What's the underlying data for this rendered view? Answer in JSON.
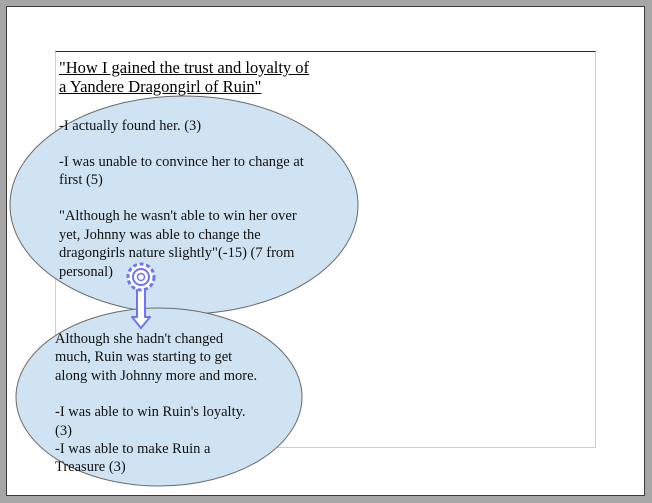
{
  "document": {
    "title_line1": "\"How I gained the trust and loyalty of",
    "title_line2": "a Yandere Dragongirl of Ruin\"",
    "top_bubble": {
      "line1": "-I actually found her. (3)",
      "line2": "-I was unable to convince her to change at",
      "line3": "first (5)",
      "line4": "\"Although he wasn't able to win her over",
      "line5": "yet, Johnny was able to change the",
      "line6": "dragongirls nature slightly\"(-15) (7 from",
      "line7": "personal)"
    },
    "bottom_bubble": {
      "line1": "Although she hadn't changed",
      "line2": "much, Ruin was starting to get",
      "line3": "along with Johnny more and more.",
      "line4": "-I was able to win Ruin's loyalty.",
      "line5": "(3)",
      "line6": "-I was able to make Ruin a",
      "line7": "Treasure (3)"
    }
  },
  "colors": {
    "bubble_fill": "#cfe3f2",
    "bubble_stroke": "#6a6a6a",
    "connector": "#6f74f0",
    "background": "#a6a6a6"
  },
  "icons": {
    "connector": "rosette-arrow-icon"
  }
}
